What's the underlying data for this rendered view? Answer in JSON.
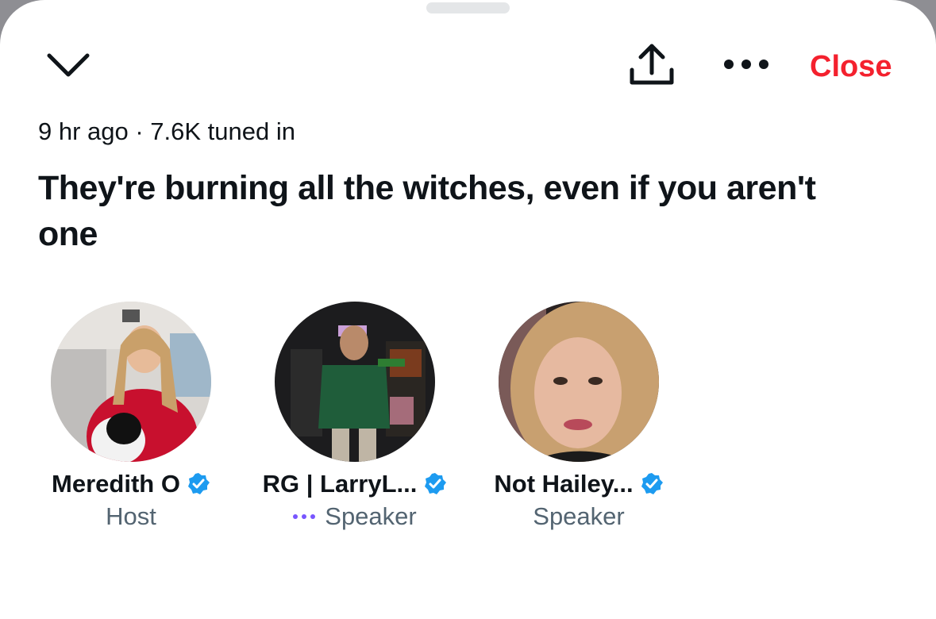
{
  "header": {
    "close_label": "Close"
  },
  "space": {
    "meta": "9 hr ago · 7.6K tuned in",
    "title": "They're burning all the witches, even if you aren't one"
  },
  "participants": [
    {
      "name": "Meredith O",
      "role": "Host",
      "verified": true
    },
    {
      "name": "RG | LarryL...",
      "role": "Speaker",
      "verified": true,
      "speaking": true
    },
    {
      "name": "Not Hailey...",
      "role": "Speaker",
      "verified": true
    }
  ],
  "icons": {
    "collapse": "chevron-down-icon",
    "share": "share-upload-icon",
    "more": "more-dots-icon",
    "verified": "verified-badge-icon"
  },
  "colors": {
    "close": "#f4212e",
    "verified": "#1d9bf0",
    "speaking_dots": "#7856ff",
    "role_text": "#536471"
  }
}
